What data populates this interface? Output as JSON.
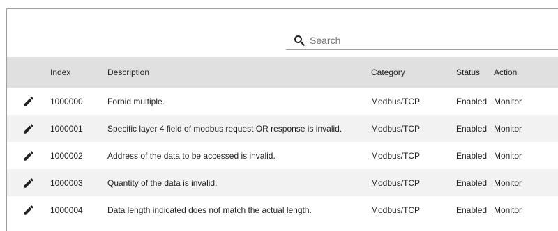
{
  "search": {
    "placeholder": "Search"
  },
  "table": {
    "columns": {
      "index": "Index",
      "description": "Description",
      "category": "Category",
      "status": "Status",
      "action": "Action"
    },
    "rows": [
      {
        "index": "1000000",
        "description": "Forbid multiple.",
        "category": "Modbus/TCP",
        "status": "Enabled",
        "action": "Monitor"
      },
      {
        "index": "1000001",
        "description": "Specific layer 4 field of modbus request OR response is invalid.",
        "category": "Modbus/TCP",
        "status": "Enabled",
        "action": "Monitor"
      },
      {
        "index": "1000002",
        "description": "Address of the data to be accessed is invalid.",
        "category": "Modbus/TCP",
        "status": "Enabled",
        "action": "Monitor"
      },
      {
        "index": "1000003",
        "description": "Quantity of the data is invalid.",
        "category": "Modbus/TCP",
        "status": "Enabled",
        "action": "Monitor"
      },
      {
        "index": "1000004",
        "description": "Data length indicated does not match the actual length.",
        "category": "Modbus/TCP",
        "status": "Enabled",
        "action": "Monitor"
      }
    ]
  },
  "icons": {
    "search": "search-icon",
    "edit": "edit-pencil-icon"
  },
  "colors": {
    "header_bg": "#e0e0e0",
    "alt_row_bg": "#f2f2f2",
    "text": "#212121"
  }
}
